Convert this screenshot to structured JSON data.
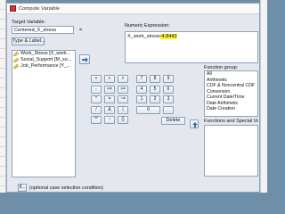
{
  "window": {
    "title": "Compute Variable"
  },
  "target": {
    "label": "Target Variable:",
    "value": "Centered_X_stress"
  },
  "equals": "=",
  "type_label_button": "Type & Label...",
  "variables": [
    {
      "label": "Work_Stress [X_work...",
      "icon": "scale-ruler-icon"
    },
    {
      "label": "Social_Support [M_so...",
      "icon": "scale-ruler-icon"
    },
    {
      "label": "Job_Performance [Y_...",
      "icon": "scale-ruler-icon"
    }
  ],
  "expression": {
    "label": "Numeric Expression:",
    "prefix": "X_work_stress",
    "highlighted": "-4.8442",
    "highlight_color": "#f7ef2a"
  },
  "keypad": {
    "rows": [
      [
        "+",
        "<",
        ">",
        "7",
        "8",
        "9"
      ],
      [
        "-",
        "<=",
        ">=",
        "4",
        "5",
        "6"
      ],
      [
        "*",
        "=",
        "~=",
        "1",
        "2",
        "3"
      ],
      [
        "/",
        "&",
        "|",
        "0",
        "."
      ],
      [
        "**",
        "~",
        "()"
      ]
    ],
    "delete_label": "Delete"
  },
  "function_group": {
    "label": "Function group:",
    "items": [
      "All",
      "Arithmetic",
      "CDF & Noncentral CDF",
      "Conversion",
      "Current Date/Time",
      "Date Arithmetic",
      "Date Creation"
    ]
  },
  "functions_label": "Functions and Special Variables:",
  "if": {
    "button": "If...",
    "text": "(optional case selection condition)"
  }
}
